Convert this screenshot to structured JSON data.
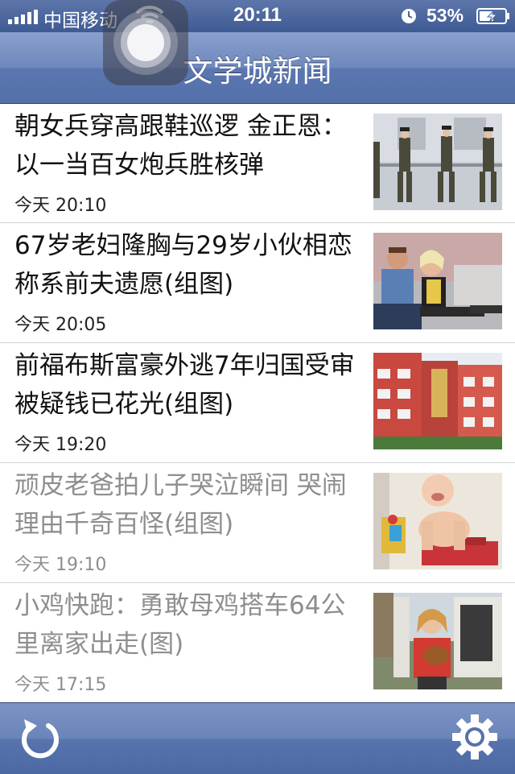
{
  "status_bar": {
    "carrier": "中国移动",
    "time": "20:11",
    "battery": "53%"
  },
  "nav": {
    "title": "文学城新闻"
  },
  "news": [
    {
      "title": "朝女兵穿高跟鞋巡逻 金正恩：以一当百女炮兵胜核弹",
      "day": "今天",
      "time": "20:10",
      "read": false,
      "thumb": "soldiers-photo"
    },
    {
      "title": "67岁老妇隆胸与29岁小伙相恋 称系前夫遗愿(组图)",
      "day": "今天",
      "time": "20:05",
      "read": false,
      "thumb": "couple-photo"
    },
    {
      "title": "前福布斯富豪外逃7年归国受审 被疑钱已花光(组图)",
      "day": "今天",
      "time": "19:20",
      "read": false,
      "thumb": "building-photo"
    },
    {
      "title": "顽皮老爸拍儿子哭泣瞬间 哭闹理由千奇百怪(组图)",
      "day": "今天",
      "time": "19:10",
      "read": true,
      "thumb": "crying-baby-photo"
    },
    {
      "title": "小鸡快跑：勇敢母鸡搭车64公里离家出走(图)",
      "day": "今天",
      "time": "17:15",
      "read": true,
      "thumb": "woman-hen-photo"
    }
  ],
  "toolbar": {
    "refresh_icon": "refresh-icon",
    "settings_icon": "gear-icon"
  },
  "colors": {
    "nav_bar": "#6e88bd",
    "read_text": "#8e8e8e",
    "unread_text": "#111111"
  }
}
